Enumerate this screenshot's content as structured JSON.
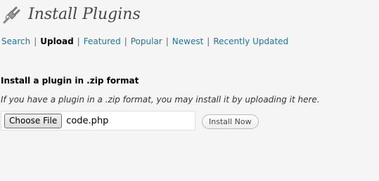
{
  "header": {
    "title": "Install Plugins",
    "icon": "plugin-icon"
  },
  "subnav": {
    "items": [
      {
        "label": "Search"
      },
      {
        "label": "Upload",
        "current": true
      },
      {
        "label": "Featured"
      },
      {
        "label": "Popular"
      },
      {
        "label": "Newest"
      },
      {
        "label": "Recently Updated"
      }
    ],
    "separator": "|"
  },
  "upload": {
    "heading": "Install a plugin in .zip format",
    "description": "If you have a plugin in a .zip format, you may install it by uploading it here.",
    "choose_file_label": "Choose File",
    "file_name": "code.php",
    "install_label": "Install Now"
  },
  "colors": {
    "link": "#21759b",
    "background": "#f5f5f5"
  }
}
